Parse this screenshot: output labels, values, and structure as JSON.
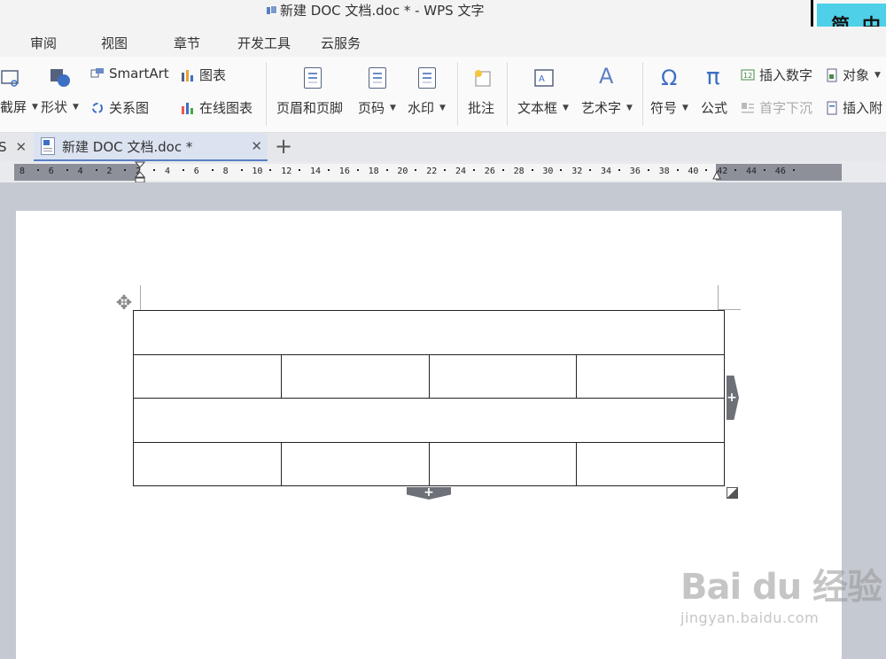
{
  "window": {
    "title": "新建 DOC 文档.doc * - WPS 文字"
  },
  "language_badge": {
    "chars": [
      "简",
      "中"
    ]
  },
  "menu_tabs": [
    "审阅",
    "视图",
    "章节",
    "开发工具",
    "云服务"
  ],
  "ribbon": {
    "screenshot_label": "截屏",
    "shape_label": "形状",
    "smartart_label": "SmartArt",
    "chart_label": "图表",
    "relation_label": "关系图",
    "online_chart_label": "在线图表",
    "header_footer_label": "页眉和页脚",
    "page_number_label": "页码",
    "watermark_label": "水印",
    "comment_label": "批注",
    "textbox_label": "文本框",
    "wordart_label": "艺术字",
    "symbol_label": "符号",
    "formula_label": "公式",
    "insert_number_label": "插入数字",
    "object_label": "对象",
    "drop_cap_label": "首字下沉",
    "insert_attach_label": "插入附",
    "symbol_glyph": "Ω",
    "formula_glyph": "π",
    "wordart_glyph": "A"
  },
  "doc_tabs": [
    {
      "label": "S",
      "active": false
    },
    {
      "label": "新建 DOC 文档.doc *",
      "active": true
    }
  ],
  "ruler": {
    "ticks": [
      "8",
      "6",
      "4",
      "2",
      "2",
      "4",
      "6",
      "8",
      "10",
      "12",
      "14",
      "16",
      "18",
      "20",
      "22",
      "24",
      "26",
      "28",
      "30",
      "32",
      "34",
      "36",
      "38",
      "40",
      "42",
      "44",
      "46"
    ]
  },
  "table": {
    "rows": [
      1,
      4,
      1,
      4
    ]
  },
  "table_controls": {
    "add_symbol": "+"
  },
  "watermark": {
    "brand": "Bai du 经验",
    "url": "jingyan.baidu.com"
  },
  "colors": {
    "accent": "#5b7fc7",
    "badge": "#4ed0e8",
    "ruler_gray": "#8d9099"
  }
}
